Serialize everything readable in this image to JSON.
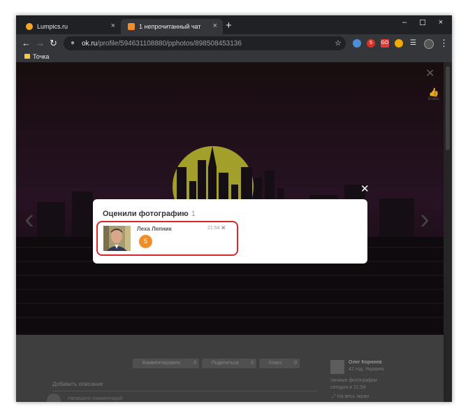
{
  "browser": {
    "tabs": [
      {
        "title": "Lumpics.ru",
        "close": "×",
        "favicon_color": "#f5a623",
        "active": false
      },
      {
        "title": "1 непрочитанный чат",
        "close": "×",
        "favicon_color": "#ef8d29",
        "active": true
      }
    ],
    "new_tab": "+",
    "window_controls": {
      "minimize": "–",
      "maximize": "☐",
      "close": "×"
    },
    "nav": {
      "back": "←",
      "forward": "→",
      "reload": "↻"
    },
    "address": {
      "host": "ok.ru",
      "path": "/profile/594631108880/pphotos/898508453136",
      "lock": "🔒",
      "star": "☆"
    },
    "extensions": [
      {
        "name": "ext-blue-icon",
        "color": "#4a90d9",
        "label": ""
      },
      {
        "name": "ext-red-badge-icon",
        "color": "#d93025",
        "label": "5"
      },
      {
        "name": "ext-red-square-icon",
        "color": "#e53935",
        "label": "GO"
      },
      {
        "name": "ext-orange-icon",
        "color": "#f2a900",
        "label": ""
      }
    ],
    "menu": "⋮"
  },
  "bookmarks": {
    "items": [
      {
        "label": "Точка"
      }
    ]
  },
  "photo_viewer": {
    "close": "✕",
    "like_label": "Класс",
    "prev_arrow": "‹",
    "next_arrow": "›",
    "actions": {
      "comment": {
        "label": "Комментировать",
        "count": "0"
      },
      "share": {
        "label": "Поделиться",
        "count": "0"
      },
      "like": {
        "label": "Класс",
        "count": "0"
      }
    },
    "description_placeholder": "Добавить описание",
    "comment_placeholder": "Напишите комментарий",
    "owner": {
      "name": "Олег Корнеев",
      "info": "42 год, Украина",
      "album": "личные фотографии",
      "time": "сегодня в 21:54",
      "fullscreen": "На весь экран"
    }
  },
  "modal": {
    "title": "Оценили фотографию",
    "count": "1",
    "close": "✕",
    "entries": [
      {
        "name": "Леха Лепник",
        "time": "21:54",
        "grade": "5",
        "remove": "✕"
      }
    ]
  },
  "colors": {
    "accent": "#ef8d29",
    "highlight": "#d9262c",
    "moon": "#c8c43a"
  }
}
